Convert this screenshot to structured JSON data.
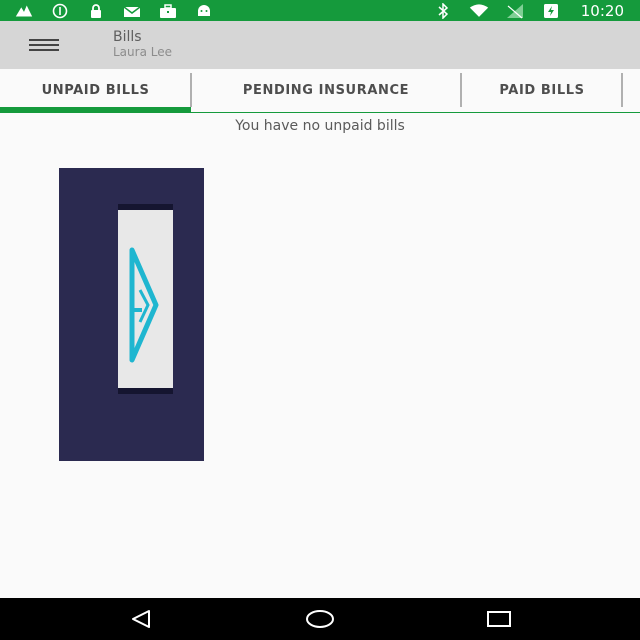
{
  "status_bar": {
    "time": "10:20",
    "left_icons": [
      "fire-icon",
      "info-icon",
      "lock-icon",
      "mail-icon",
      "briefcase-icon",
      "android-icon"
    ],
    "right_icons": [
      "bluetooth-icon",
      "wifi-icon",
      "signal-icon",
      "battery-icon"
    ]
  },
  "toolbar": {
    "title": "Bills",
    "subtitle": "Laura Lee"
  },
  "tabs": [
    {
      "label": "UNPAID BILLS",
      "active": true
    },
    {
      "label": "PENDING INSURANCE",
      "active": false
    },
    {
      "label": "PAID BILLS",
      "active": false
    }
  ],
  "content": {
    "empty_message": "You have no unpaid bills"
  },
  "colors": {
    "primary": "#159a3c",
    "toolbar": "#d6d6d6",
    "promo_background": "#2b2a50",
    "logo_accent": "#1fb6d0"
  },
  "nav_bar": {
    "buttons": [
      "back-icon",
      "home-icon",
      "recents-icon"
    ]
  }
}
